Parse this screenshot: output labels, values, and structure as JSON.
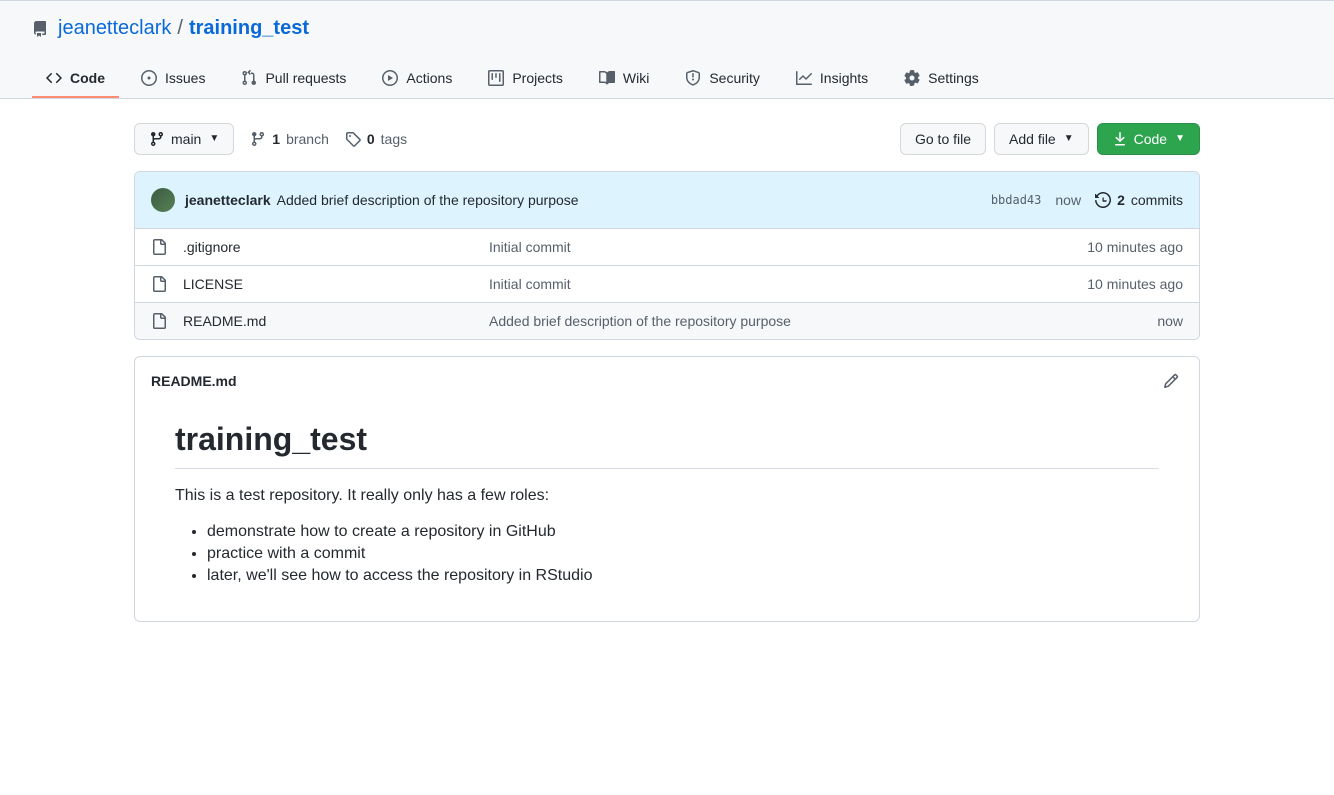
{
  "breadcrumb": {
    "owner": "jeanetteclark",
    "separator": "/",
    "repo": "training_test"
  },
  "tabs": [
    {
      "label": "Code",
      "active": true
    },
    {
      "label": "Issues",
      "active": false
    },
    {
      "label": "Pull requests",
      "active": false
    },
    {
      "label": "Actions",
      "active": false
    },
    {
      "label": "Projects",
      "active": false
    },
    {
      "label": "Wiki",
      "active": false
    },
    {
      "label": "Security",
      "active": false
    },
    {
      "label": "Insights",
      "active": false
    },
    {
      "label": "Settings",
      "active": false
    }
  ],
  "branch_button": "main",
  "branch_stat": {
    "count": "1",
    "label": "branch"
  },
  "tags_stat": {
    "count": "0",
    "label": "tags"
  },
  "buttons": {
    "go_to_file": "Go to file",
    "add_file": "Add file",
    "code": "Code"
  },
  "commit_header": {
    "author": "jeanetteclark",
    "message": "Added brief description of the repository purpose",
    "sha": "bbdad43",
    "time": "now",
    "commits_count": "2",
    "commits_label": "commits"
  },
  "files": [
    {
      "name": ".gitignore",
      "message": "Initial commit",
      "time": "10 minutes ago"
    },
    {
      "name": "LICENSE",
      "message": "Initial commit",
      "time": "10 minutes ago"
    },
    {
      "name": "README.md",
      "message": "Added brief description of the repository purpose",
      "time": "now"
    }
  ],
  "readme": {
    "filename": "README.md",
    "heading": "training_test",
    "intro": "This is a test repository. It really only has a few roles:",
    "bullets": [
      "demonstrate how to create a repository in GitHub",
      "practice with a commit",
      "later, we'll see how to access the repository in RStudio"
    ]
  }
}
